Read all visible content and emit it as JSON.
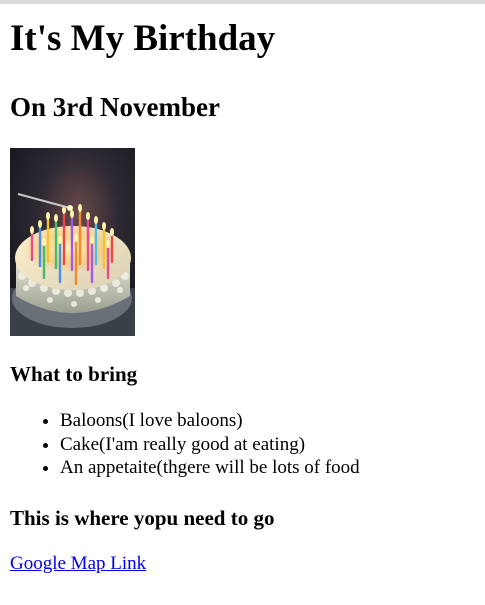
{
  "header": {
    "title": "It's My Birthday",
    "date": "On 3rd November"
  },
  "image": {
    "name": "birthday-cake-with-candles"
  },
  "bring": {
    "heading": "What to bring",
    "items": [
      "Baloons(I love baloons)",
      "Cake(I'am really good at eating)",
      "An appetaite(thgere will be lots of food"
    ]
  },
  "location": {
    "heading": "This is where yopu need to go",
    "link_text": "Google Map Link"
  },
  "colors": {
    "link": "#0000ee",
    "text": "#000000",
    "background": "#ffffff"
  }
}
